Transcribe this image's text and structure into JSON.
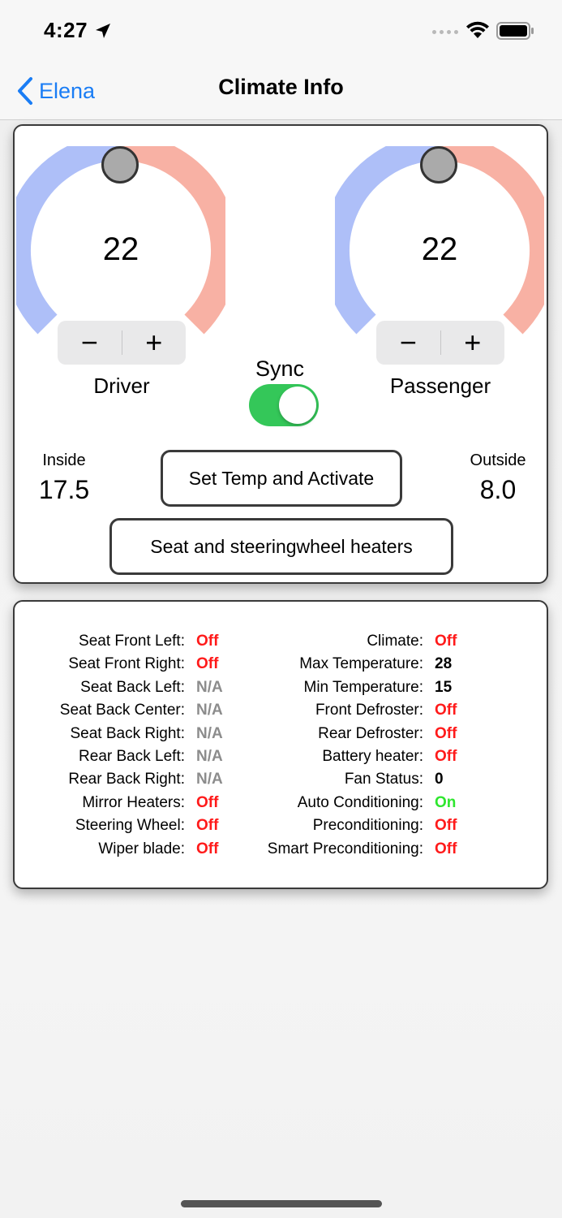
{
  "status_bar": {
    "time": "4:27"
  },
  "nav": {
    "back_label": "Elena",
    "title": "Climate Info"
  },
  "driver": {
    "value": "22",
    "label": "Driver",
    "minus": "−",
    "plus": "+"
  },
  "passenger": {
    "value": "22",
    "label": "Passenger",
    "minus": "−",
    "plus": "+"
  },
  "sync": {
    "label": "Sync",
    "on": true
  },
  "inside": {
    "label": "Inside",
    "value": "17.5"
  },
  "outside": {
    "label": "Outside",
    "value": "8.0"
  },
  "buttons": {
    "set_temp": "Set Temp and Activate",
    "seat_heaters": "Seat and steeringwheel heaters"
  },
  "colors": {
    "accent_blue": "#1a7df5",
    "dial_cold": "#aebff8",
    "dial_hot": "#f8b1a4",
    "toggle_on": "#34c759",
    "status_off": "#ff1a1a",
    "status_on": "#2ee62e",
    "status_na": "#8c8c8c"
  },
  "left_status": [
    {
      "label": "Seat Front Left:",
      "value": "Off",
      "kind": "off"
    },
    {
      "label": "Seat Front Right:",
      "value": "Off",
      "kind": "off"
    },
    {
      "label": "Seat Back Left:",
      "value": "N/A",
      "kind": "na"
    },
    {
      "label": "Seat Back Center:",
      "value": "N/A",
      "kind": "na"
    },
    {
      "label": "Seat Back Right:",
      "value": "N/A",
      "kind": "na"
    },
    {
      "label": "Rear Back Left:",
      "value": "N/A",
      "kind": "na"
    },
    {
      "label": "Rear Back Right:",
      "value": "N/A",
      "kind": "na"
    },
    {
      "label": "Mirror Heaters:",
      "value": "Off",
      "kind": "off"
    },
    {
      "label": "Steering Wheel:",
      "value": "Off",
      "kind": "off"
    },
    {
      "label": "Wiper blade:",
      "value": "Off",
      "kind": "off"
    }
  ],
  "right_status": [
    {
      "label": "Climate:",
      "value": "Off",
      "kind": "off"
    },
    {
      "label": "Max Temperature:",
      "value": "28",
      "kind": "num"
    },
    {
      "label": "Min Temperature:",
      "value": "15",
      "kind": "num"
    },
    {
      "label": "Front Defroster:",
      "value": "Off",
      "kind": "off"
    },
    {
      "label": "Rear Defroster:",
      "value": "Off",
      "kind": "off"
    },
    {
      "label": "Battery heater:",
      "value": "Off",
      "kind": "off"
    },
    {
      "label": "Fan Status:",
      "value": "0",
      "kind": "num"
    },
    {
      "label": "Auto Conditioning:",
      "value": "On",
      "kind": "on"
    },
    {
      "label": "Preconditioning:",
      "value": "Off",
      "kind": "off"
    },
    {
      "label": "Smart Preconditioning:",
      "value": "Off",
      "kind": "off"
    }
  ],
  "icons": {
    "location": "location-arrow-icon",
    "wifi": "wifi-icon",
    "battery": "battery-icon",
    "back": "chevron-left-icon"
  }
}
